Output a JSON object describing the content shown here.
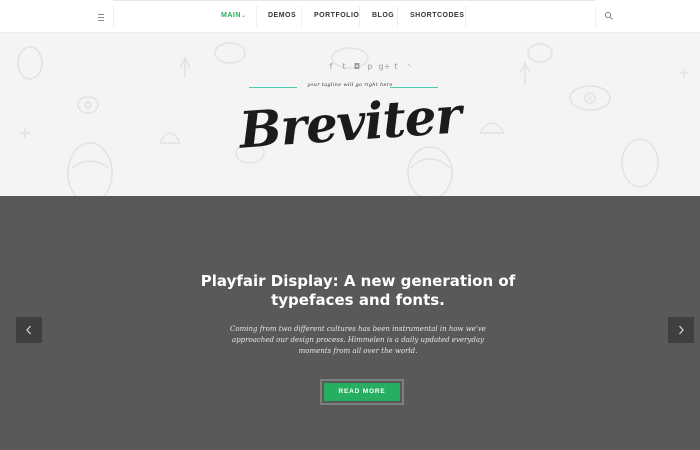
{
  "nav": {
    "menu_icon": "menu-icon",
    "items": [
      {
        "label": "MAIN",
        "active": true
      },
      {
        "label": "DEMOS",
        "active": false
      },
      {
        "label": "PORTFOLIO",
        "active": false
      },
      {
        "label": "BLOG",
        "active": false
      },
      {
        "label": "SHORTCODES",
        "active": false
      }
    ],
    "caret": "⌄",
    "search_icon": "search-icon"
  },
  "header": {
    "social": [
      {
        "icon": "facebook-icon",
        "glyph": "f"
      },
      {
        "icon": "twitter-icon",
        "glyph": "t"
      },
      {
        "icon": "instagram-icon",
        "glyph": "◘"
      },
      {
        "icon": "pinterest-icon",
        "glyph": "p"
      },
      {
        "icon": "google-plus-icon",
        "glyph": "g+"
      },
      {
        "icon": "tumblr-icon",
        "glyph": "t"
      },
      {
        "icon": "rss-icon",
        "glyph": "◝"
      }
    ],
    "tagline": "your tagline will go right here",
    "logo": "Breviter"
  },
  "slider": {
    "title": "Playfair Display: A new generation of typefaces and fonts.",
    "text": "Coming from two different cultures has been instrumental in how we've approached our design process. Himmelen is a daily updated everyday moments from all over the world.",
    "button_label": "READ MORE",
    "prev_icon": "chevron-left-icon",
    "next_icon": "chevron-right-icon"
  },
  "colors": {
    "accent": "#27ae60",
    "slider_bg": "#595959",
    "header_bg": "#f4f4f4",
    "tagline_line": "#4ecbb2"
  }
}
